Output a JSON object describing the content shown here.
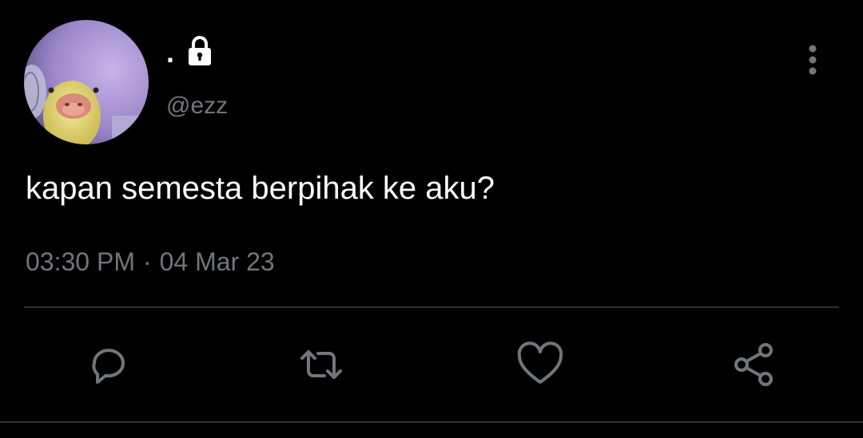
{
  "user": {
    "display_name": ".",
    "handle": "@ezz",
    "protected": true,
    "avatar_subject": "duck"
  },
  "tweet": {
    "text": "kapan semesta berpihak ke aku?",
    "time": "03:30 PM",
    "separator": "·",
    "date": "04 Mar 23"
  },
  "actions": [
    {
      "name": "reply",
      "icon": "reply-icon"
    },
    {
      "name": "retweet",
      "icon": "retweet-icon"
    },
    {
      "name": "like",
      "icon": "heart-icon"
    },
    {
      "name": "share",
      "icon": "share-icon"
    }
  ],
  "colors": {
    "background": "#000000",
    "text": "#ffffff",
    "secondary": "#71767b",
    "divider": "#2f3336"
  }
}
